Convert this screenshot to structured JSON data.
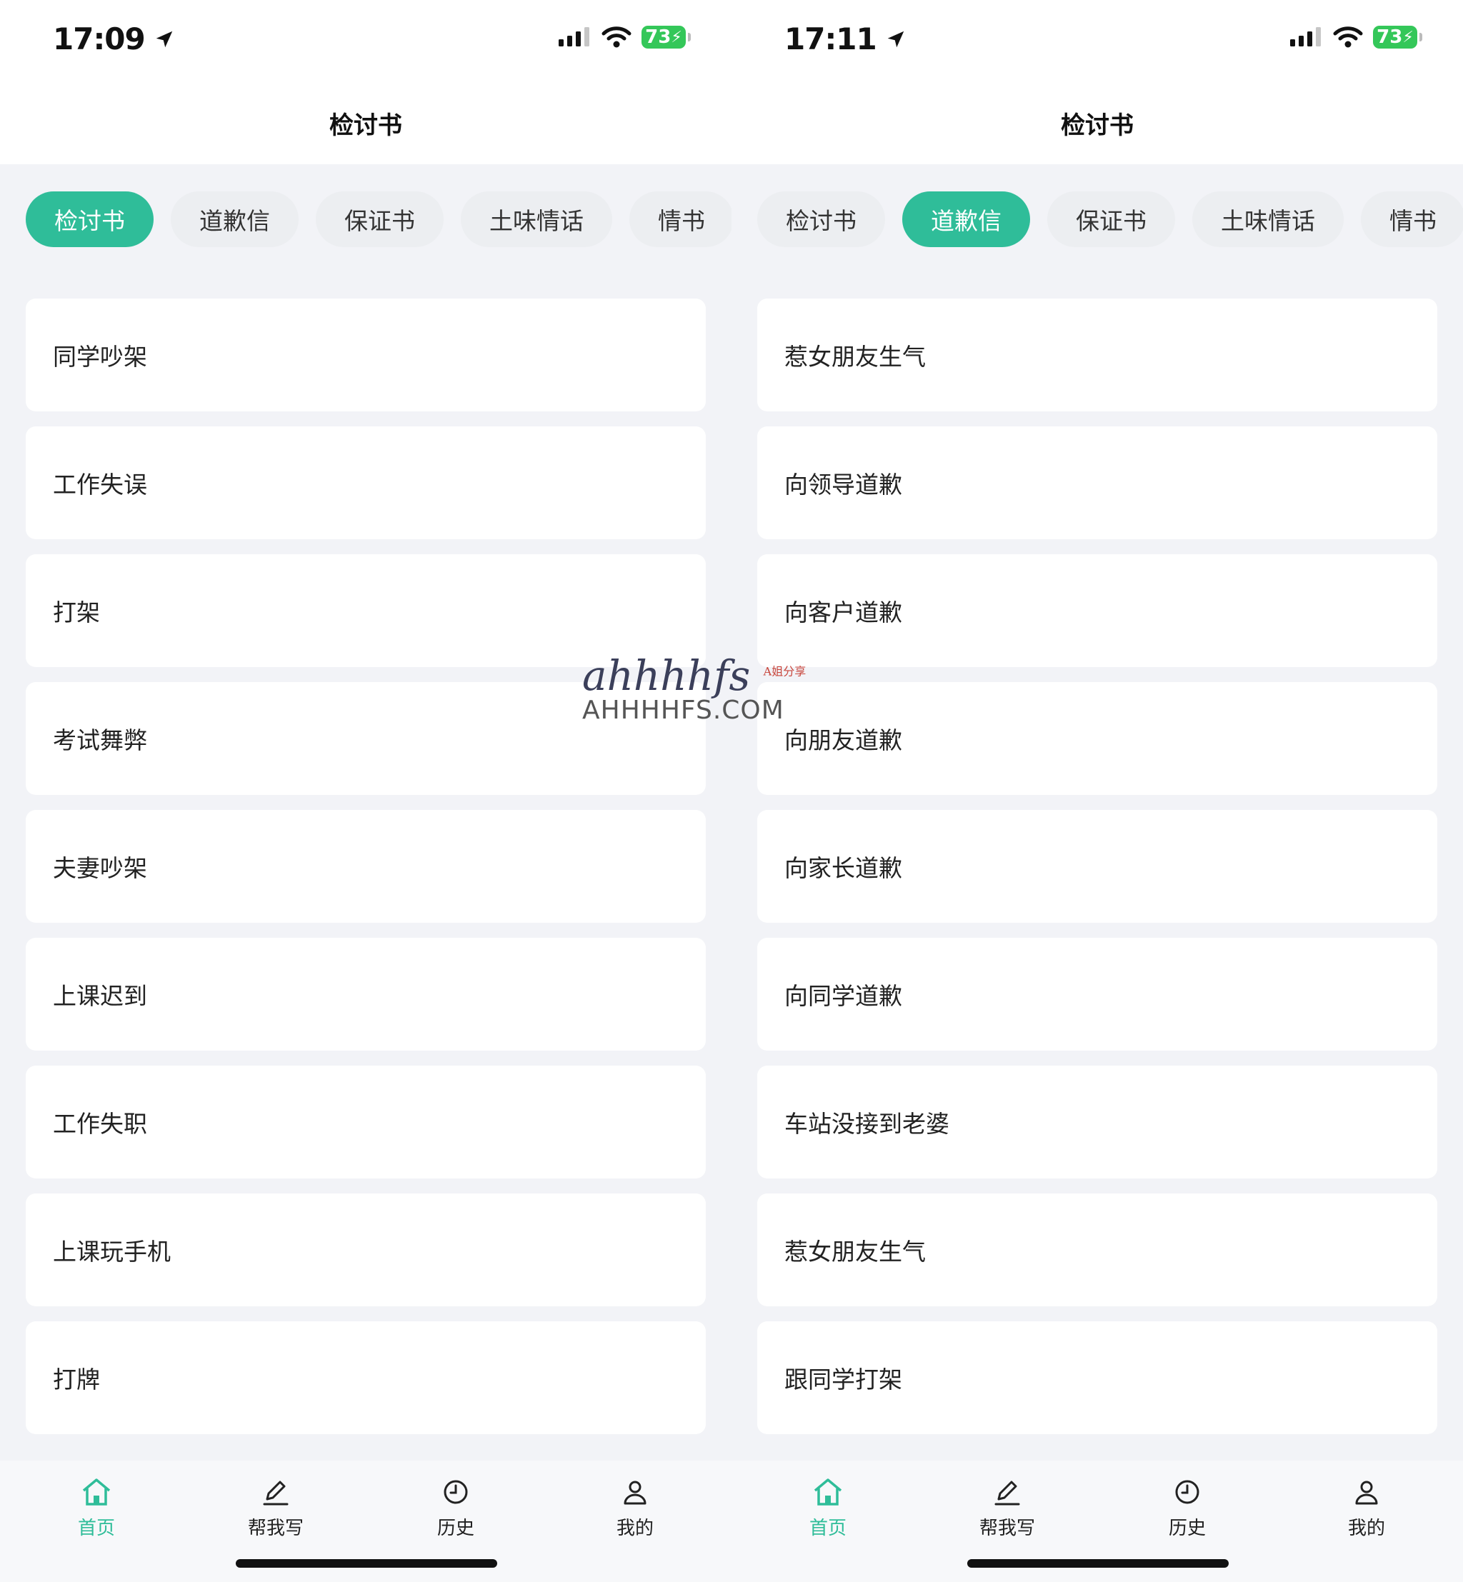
{
  "screens": [
    {
      "status": {
        "time": "17:09",
        "battery": "73"
      },
      "nav_title": "检讨书",
      "chips": [
        "检讨书",
        "道歉信",
        "保证书",
        "土味情话",
        "情书"
      ],
      "active_chip": 0,
      "items": [
        "同学吵架",
        "工作失误",
        "打架",
        "考试舞弊",
        "夫妻吵架",
        "上课迟到",
        "工作失职",
        "上课玩手机",
        "打牌"
      ],
      "tabs": [
        {
          "label": "首页",
          "icon": "home-icon"
        },
        {
          "label": "帮我写",
          "icon": "pencil-icon"
        },
        {
          "label": "历史",
          "icon": "clock-icon"
        },
        {
          "label": "我的",
          "icon": "user-icon"
        }
      ],
      "active_tab": 0
    },
    {
      "status": {
        "time": "17:11",
        "battery": "73"
      },
      "nav_title": "检讨书",
      "chips": [
        "检讨书",
        "道歉信",
        "保证书",
        "土味情话",
        "情书"
      ],
      "active_chip": 1,
      "items": [
        "惹女朋友生气",
        "向领导道歉",
        "向客户道歉",
        "向朋友道歉",
        "向家长道歉",
        "向同学道歉",
        "车站没接到老婆",
        "惹女朋友生气",
        "跟同学打架"
      ],
      "tabs": [
        {
          "label": "首页",
          "icon": "home-icon"
        },
        {
          "label": "帮我写",
          "icon": "pencil-icon"
        },
        {
          "label": "历史",
          "icon": "clock-icon"
        },
        {
          "label": "我的",
          "icon": "user-icon"
        }
      ],
      "active_tab": 0
    }
  ],
  "watermark": {
    "logo_text": "ahhhhfs",
    "logo_sub": "A姐分享",
    "url": "AHHHHFS.COM"
  },
  "colors": {
    "accent": "#2fbd99",
    "background": "#f2f3f7",
    "card": "#ffffff",
    "battery": "#34c759"
  }
}
